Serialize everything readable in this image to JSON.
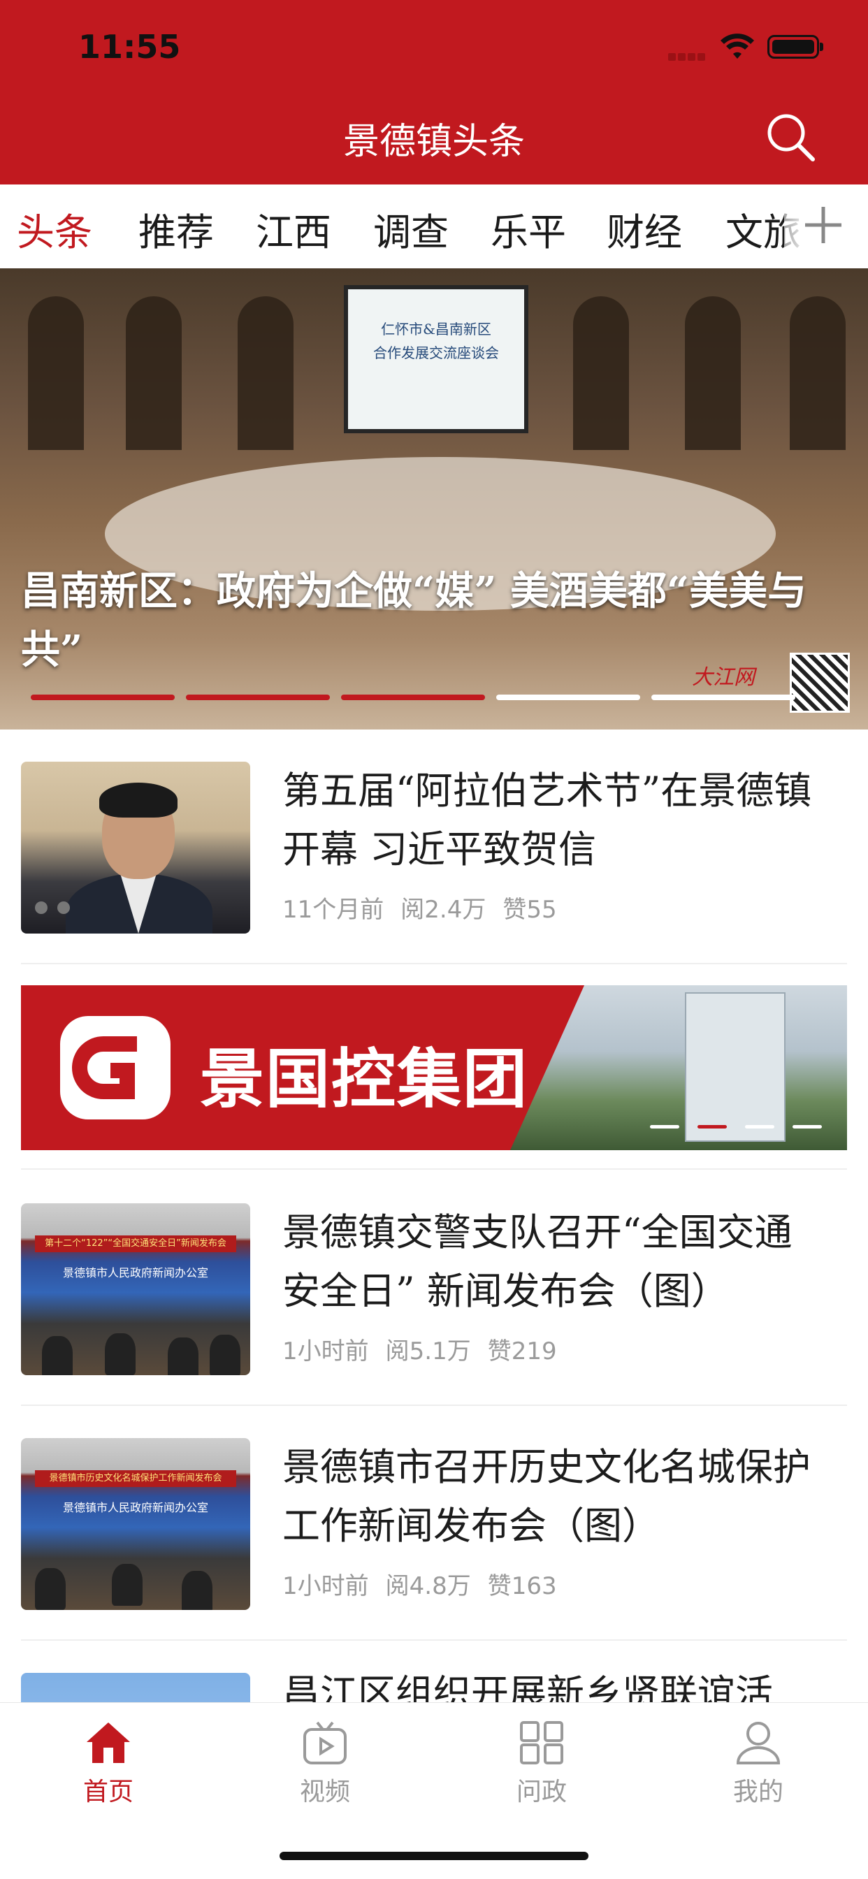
{
  "status_bar": {
    "time": "11:55"
  },
  "header": {
    "title": "景德镇头条"
  },
  "tabs": [
    {
      "label": "头条",
      "active": true
    },
    {
      "label": "推荐",
      "active": false
    },
    {
      "label": "江西",
      "active": false
    },
    {
      "label": "调查",
      "active": false
    },
    {
      "label": "乐平",
      "active": false
    },
    {
      "label": "财经",
      "active": false
    },
    {
      "label": "文旅",
      "active": false
    }
  ],
  "hero": {
    "caption": "昌南新区：政府为企做“媒” 美酒美都“美美与共”",
    "screen_text": "仁怀市&昌南新区\n合作发展交流座谈会",
    "watermark": "大江网",
    "slide_count": 5,
    "active_slides": 3
  },
  "news": [
    {
      "title": "第五届“阿拉伯艺术节”在景德镇开幕 习近平致贺信",
      "time": "11个月前",
      "reads": "阅2.4万",
      "likes": "赞55"
    },
    {
      "title": "景德镇交警支队召开“全国交通安全日” 新闻发布会（图）",
      "time": "1小时前",
      "reads": "阅5.1万",
      "likes": "赞219",
      "thumb_banner": "第十二个“122”“全国交通安全日”新闻发布会",
      "thumb_sign": "景德镇市人民政府新闻办公室"
    },
    {
      "title": "景德镇市召开历史文化名城保护工作新闻发布会（图）",
      "time": "1小时前",
      "reads": "阅4.8万",
      "likes": "赞163",
      "thumb_banner": "景德镇市历史文化名城保护工作新闻发布会",
      "thumb_sign": "景德镇市人民政府新闻办公室"
    },
    {
      "title": "昌江区组织开展新乡贤联谊活"
    }
  ],
  "ad": {
    "text": "景国控集团",
    "slide_count": 4,
    "active_index": 1
  },
  "bottom_nav": [
    {
      "label": "首页",
      "icon": "home-icon",
      "active": true
    },
    {
      "label": "视频",
      "icon": "tv-icon",
      "active": false
    },
    {
      "label": "问政",
      "icon": "grid-icon",
      "active": false
    },
    {
      "label": "我的",
      "icon": "user-icon",
      "active": false
    }
  ],
  "colors": {
    "brand": "#c1191f",
    "meta": "#9a9a9a",
    "text": "#1c1c1c"
  }
}
